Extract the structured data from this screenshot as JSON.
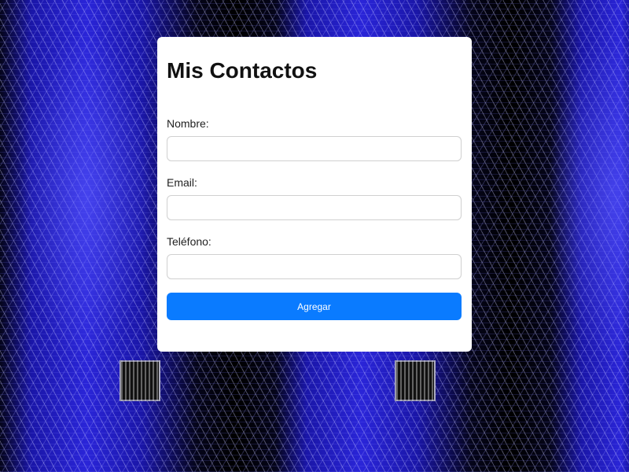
{
  "form": {
    "title": "Mis Contactos",
    "name_label": "Nombre:",
    "name_value": "",
    "email_label": "Email:",
    "email_value": "",
    "phone_label": "Teléfono:",
    "phone_value": "",
    "submit_label": "Agregar"
  },
  "colors": {
    "accent": "#0a7bff",
    "card_background": "#ffffff",
    "page_background": "#1a16a8"
  }
}
